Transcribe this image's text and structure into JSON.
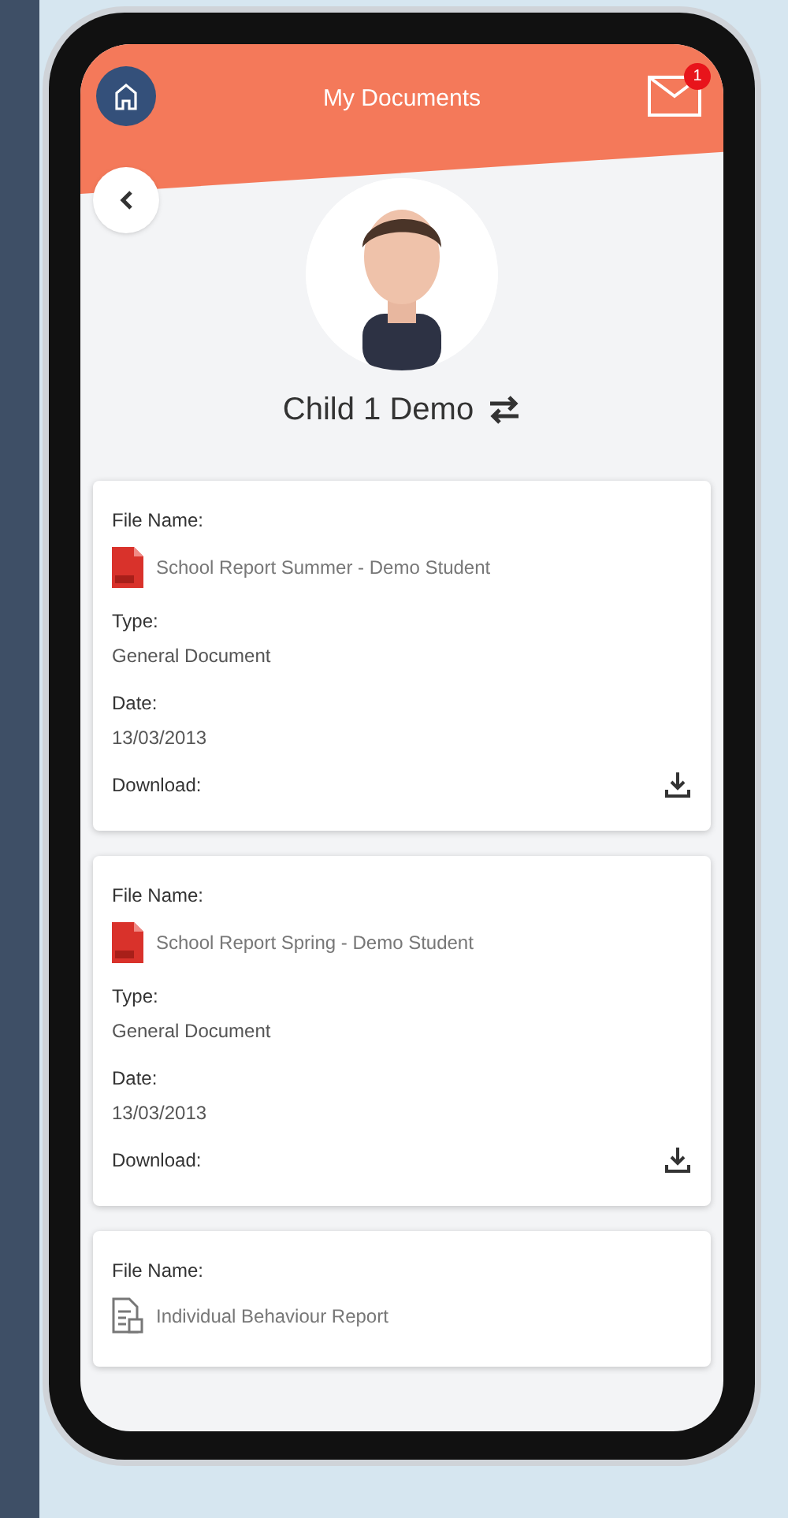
{
  "header": {
    "title": "My Documents",
    "notification_count": "1"
  },
  "profile": {
    "name": "Child 1 Demo"
  },
  "documents": [
    {
      "kind": "pdf",
      "fields": [
        {
          "label": "File Name:"
        },
        {
          "label": "Type:",
          "value": "General Document"
        },
        {
          "label": "Date:",
          "value": "13/03/2013"
        },
        {
          "label": "Download:"
        }
      ],
      "file_name": "School Report Summer - Demo Student"
    },
    {
      "kind": "pdf",
      "fields": [
        {
          "label": "File Name:"
        },
        {
          "label": "Type:",
          "value": "General Document"
        },
        {
          "label": "Date:",
          "value": "13/03/2013"
        },
        {
          "label": "Download:"
        }
      ],
      "file_name": "School Report Spring - Demo Student"
    },
    {
      "kind": "document",
      "fields": [
        {
          "label": "File Name:"
        }
      ],
      "file_name": "Individual Behaviour Report"
    }
  ]
}
